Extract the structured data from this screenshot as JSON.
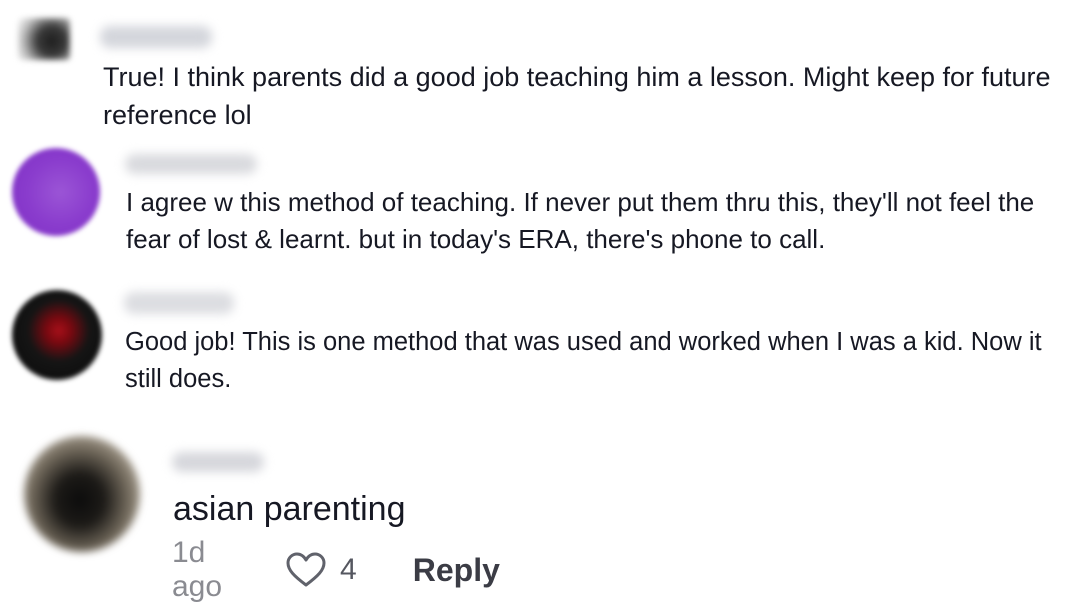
{
  "comments": [
    {
      "username": "",
      "text": "True! I think parents did a good job teaching him a lesson. Might keep for future reference lol",
      "avatar_color": "#2a2a2a"
    },
    {
      "username": "",
      "text": "I agree w this method of teaching. If never put them thru this, they'll not feel the fear of lost & learnt. but in today's ERA, there's phone to call.",
      "avatar_color": "#8a3ccd"
    },
    {
      "username": "",
      "text": "Good job! This is one method that was used and worked when I was a kid. Now it still does.",
      "avatar_color": "#a7101a"
    },
    {
      "username": "",
      "text": "asian parenting",
      "avatar_color": "#1c1a17",
      "time": "1d ago",
      "likes": "4",
      "reply_label": "Reply",
      "like_icon": "heart-outline-icon"
    }
  ]
}
